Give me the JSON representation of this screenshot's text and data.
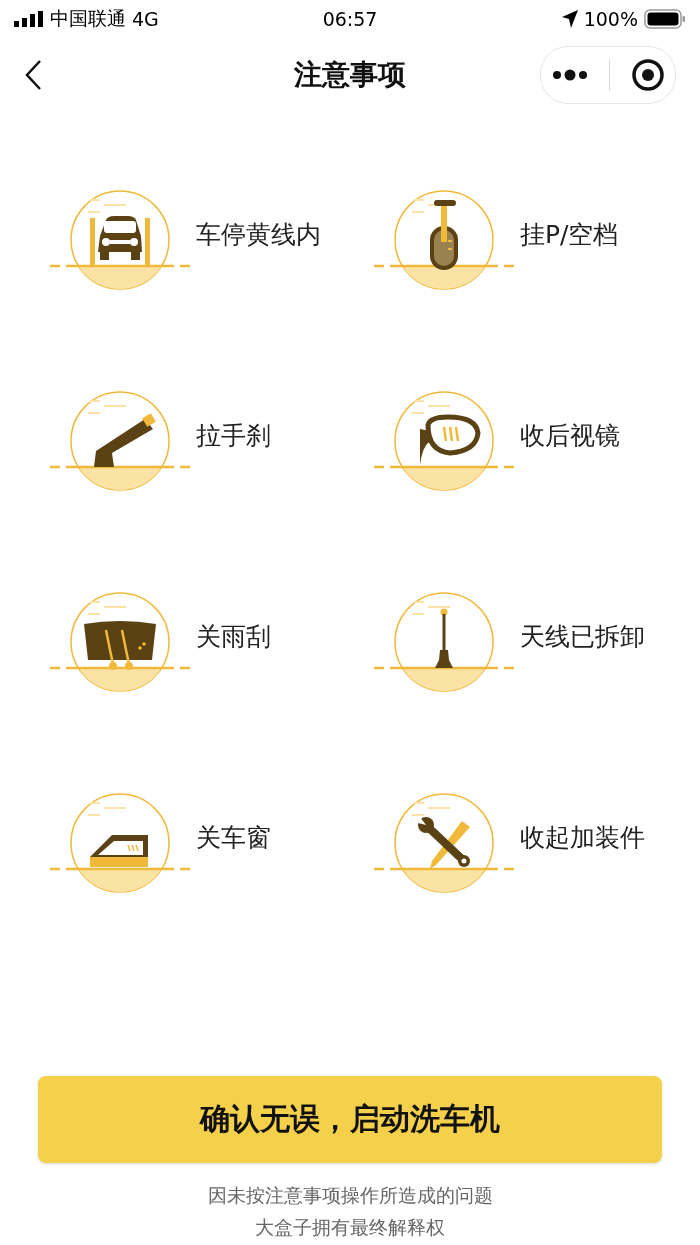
{
  "status_bar": {
    "carrier": "中国联通",
    "network": "4G",
    "time": "06:57",
    "battery": "100%"
  },
  "nav": {
    "title": "注意事项"
  },
  "items": [
    {
      "kind": "car",
      "label": "车停黄线内"
    },
    {
      "kind": "gear",
      "label": "挂P/空档"
    },
    {
      "kind": "handbrake",
      "label": "拉手刹"
    },
    {
      "kind": "mirror",
      "label": "收后视镜"
    },
    {
      "kind": "wiper",
      "label": "关雨刮"
    },
    {
      "kind": "antenna",
      "label": "天线已拆卸"
    },
    {
      "kind": "window",
      "label": "关车窗"
    },
    {
      "kind": "tools",
      "label": "收起加装件"
    }
  ],
  "confirm_button": "确认无误，启动洗车机",
  "disclaimer": [
    "因未按注意事项操作所造成的问题",
    "大盒子拥有最终解释权"
  ]
}
